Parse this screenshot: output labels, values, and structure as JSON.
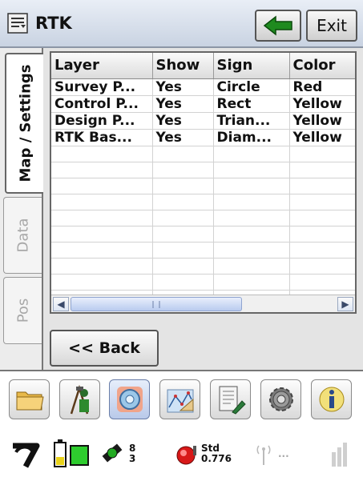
{
  "window": {
    "title": "RTK",
    "exit_label": "Exit"
  },
  "tabs": [
    {
      "label": "Map / Settings",
      "active": true
    },
    {
      "label": "Data",
      "active": false
    },
    {
      "label": "Pos",
      "active": false
    }
  ],
  "table": {
    "columns": [
      "Layer",
      "Show",
      "Sign",
      "Color"
    ],
    "rows": [
      [
        "Survey P...",
        "Yes",
        "Circle",
        "Red"
      ],
      [
        "Control P...",
        "Yes",
        "Rect",
        "Yellow"
      ],
      [
        "Design P...",
        "Yes",
        "Trian...",
        "Yellow"
      ],
      [
        "RTK Bas...",
        "Yes",
        "Diam...",
        "Yellow"
      ]
    ],
    "scroll_thumb_glyph": "III"
  },
  "back_button": {
    "label": "<< Back"
  },
  "toolbar_icons": [
    "folder-icon",
    "surveyor-icon",
    "search-disc-icon",
    "map-grid-icon",
    "notes-icon",
    "gear-icon",
    "info-icon"
  ],
  "status": {
    "satellites_top": "8",
    "satellites_bottom": "3",
    "solution_label": "Std",
    "solution_value": "0.776",
    "radio_placeholder": "..."
  },
  "colors": {
    "tab_active": "#ffffff",
    "table_border": "#666666",
    "title_gradient_start": "#e9eef6",
    "arrow_green": "#1f8a1f"
  }
}
